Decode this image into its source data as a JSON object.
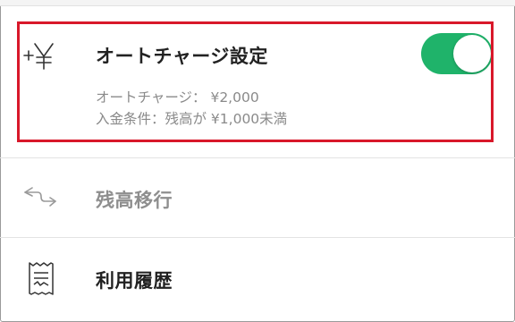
{
  "auto_charge": {
    "title": "オートチャージ設定",
    "amount_text": "オートチャージ： ¥2,000",
    "condition_text": "入金条件：残高が ¥1,000未満",
    "toggle_on": true
  },
  "balance_transfer": {
    "title": "残高移行"
  },
  "usage_history": {
    "title": "利用履歴"
  },
  "colors": {
    "toggle_on": "#1fb36a",
    "highlight_border": "#d8182a",
    "dim_text": "#8e8e8e"
  }
}
